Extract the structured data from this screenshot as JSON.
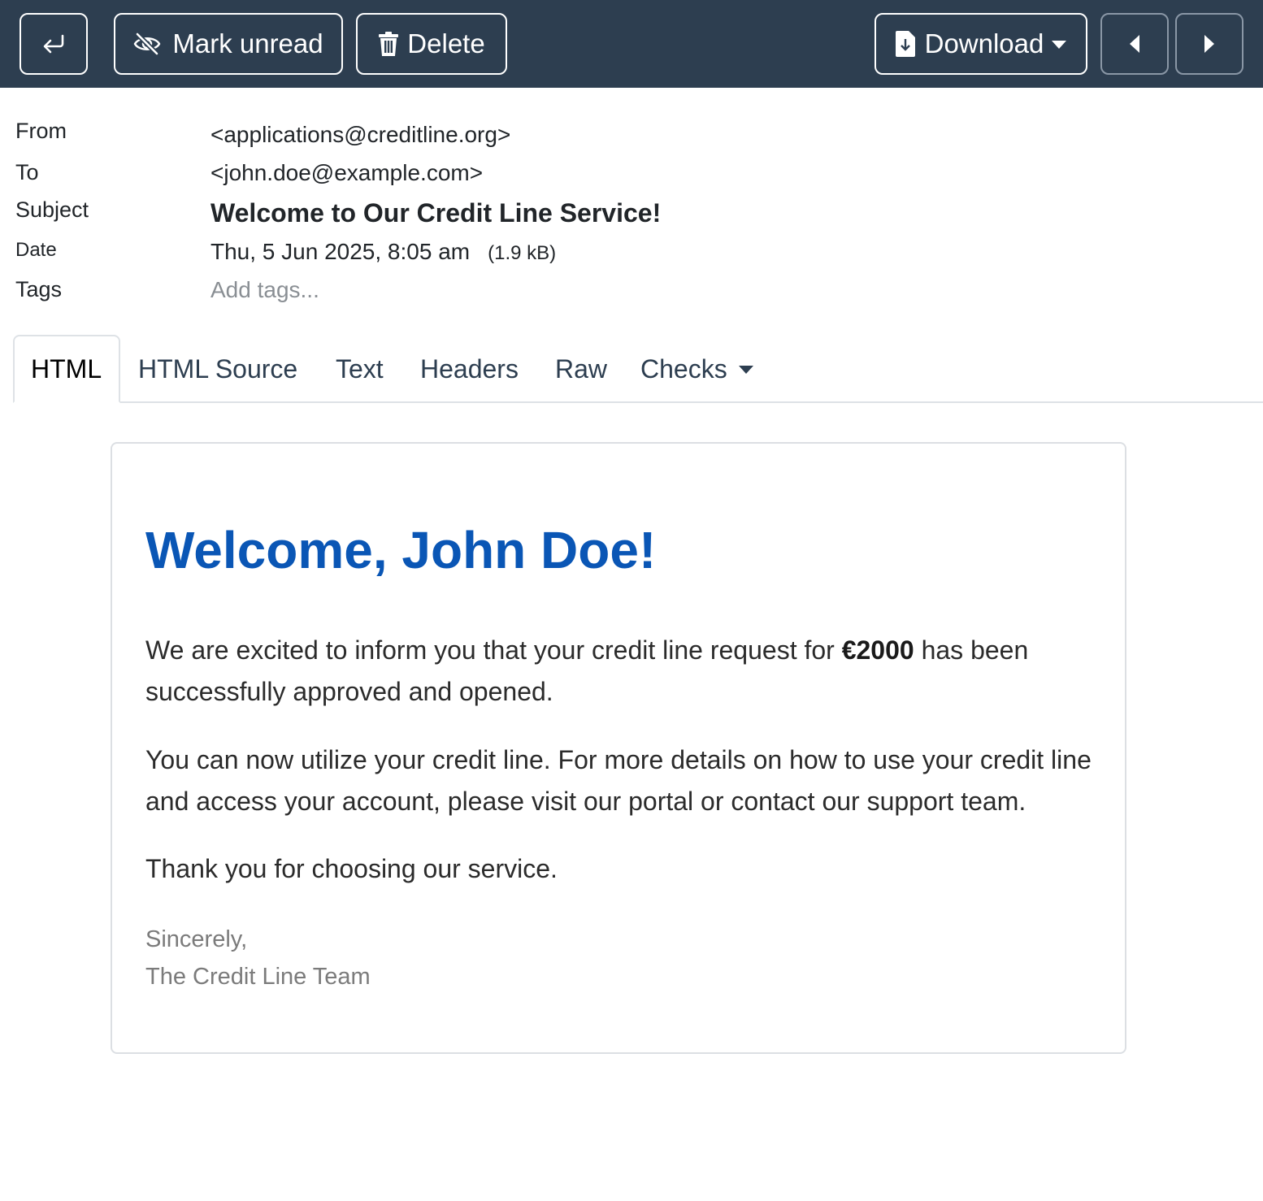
{
  "toolbar": {
    "reply_icon": "reply-icon",
    "mark_unread_label": "Mark unread",
    "mark_unread_icon": "eye-slash-icon",
    "delete_label": "Delete",
    "delete_icon": "trash-icon",
    "download_label": "Download",
    "download_icon": "file-download-icon",
    "prev_icon": "caret-left-icon",
    "next_icon": "caret-right-icon",
    "bg_color": "#2d3e50"
  },
  "headers": {
    "from_label": "From",
    "from_value": "<applications@creditline.org>",
    "to_label": "To",
    "to_value": "<john.doe@example.com>",
    "subject_label": "Subject",
    "subject_value": "Welcome to Our Credit Line Service!",
    "date_label": "Date",
    "date_value": "Thu, 5 Jun 2025, 8:05 am",
    "size_value": "(1.9 kB)",
    "tags_label": "Tags",
    "tags_placeholder": "Add tags..."
  },
  "tabs": [
    {
      "label": "HTML",
      "active": true
    },
    {
      "label": "HTML Source"
    },
    {
      "label": "Text"
    },
    {
      "label": "Headers"
    },
    {
      "label": "Raw"
    },
    {
      "label": "Checks"
    }
  ],
  "message": {
    "greeting": "Welcome, John Doe!",
    "p1_before": "We are excited to inform you that your credit line request for ",
    "p1_amount": "€2000",
    "p1_after": " has been successfully approved and opened.",
    "p2": "You can now utilize your credit line. For more details on how to use your credit line and access your account, please visit our portal or contact our support team.",
    "p3": "Thank you for choosing our service.",
    "sign_off": "Sincerely,",
    "signature": "The Credit Line Team",
    "greeting_color": "#0a56b5"
  }
}
